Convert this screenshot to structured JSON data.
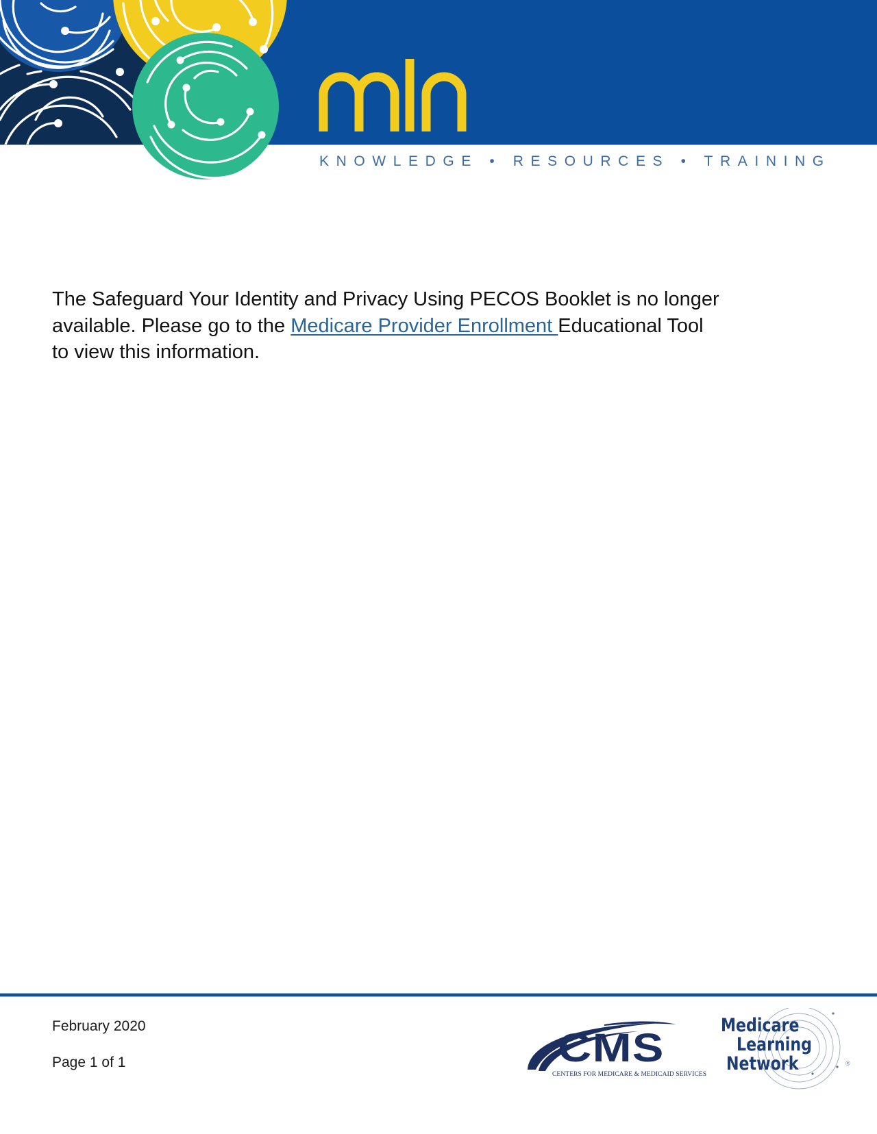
{
  "header": {
    "wordmark": "mln",
    "tagline": "KNOWLEDGE • RESOURCES • TRAINING",
    "colors": {
      "banner_blue": "#0B4F9C",
      "navy": "#0D2D52",
      "mid_blue": "#1759A8",
      "yellow": "#F2CD1F",
      "green": "#2DB88E",
      "tagline": "#3D6CA3"
    }
  },
  "body": {
    "line1": "The Safeguard Your Identity and Privacy Using PECOS Booklet is no longer",
    "line2_before_link": "available. Please go to the ",
    "link_text": "Medicare Provider Enrollment ",
    "line2_after_link": "Educational Tool",
    "line3": "to view this information.",
    "link_color": "#2A6496"
  },
  "footer": {
    "date": "February 2020",
    "page": "Page 1 of 1",
    "cms_logo": {
      "letters": "CMS",
      "subtitle": "CENTERS FOR MEDICARE & MEDICAID SERVICES"
    },
    "mln_logo": {
      "line1": "Medicare",
      "line2": "Learning",
      "line3": "Network",
      "registered": "®"
    },
    "rule_color": "#1B4F8A"
  }
}
